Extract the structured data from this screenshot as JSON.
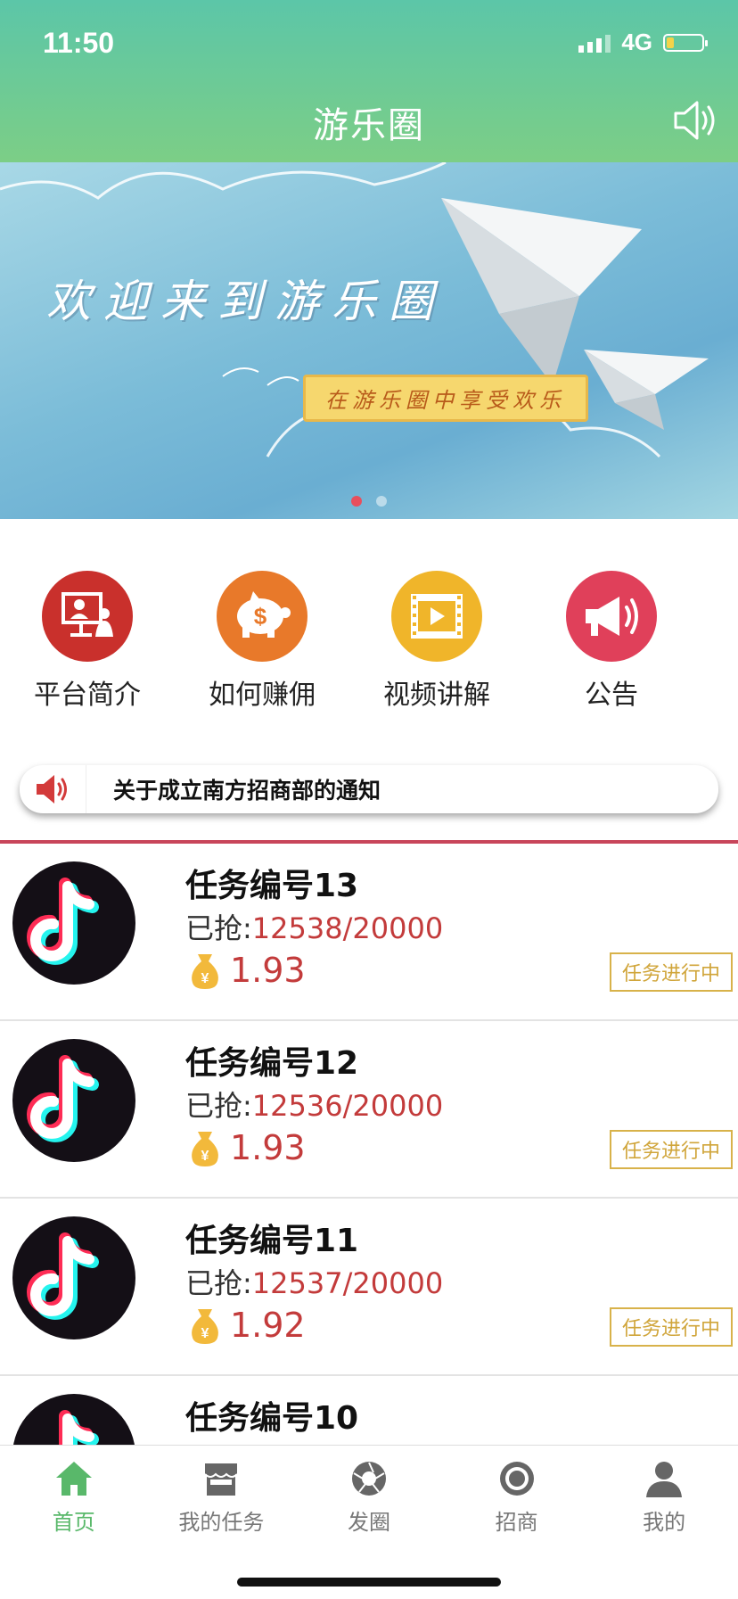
{
  "status_bar": {
    "time": "11:50",
    "network": "4G"
  },
  "header": {
    "title": "游乐圈"
  },
  "banner": {
    "headline": "欢迎来到游乐圈",
    "subtitle": "在游乐圈中享受欢乐",
    "slide_count": 2,
    "active_slide": 1
  },
  "quick_nav": [
    {
      "label": "平台简介",
      "icon": "presentation-icon",
      "color": "#c9302c"
    },
    {
      "label": "如何赚佣",
      "icon": "piggy-bank-icon",
      "color": "#e8792a"
    },
    {
      "label": "视频讲解",
      "icon": "film-icon",
      "color": "#f0b52a"
    },
    {
      "label": "公告",
      "icon": "megaphone-icon",
      "color": "#e0405a"
    }
  ],
  "notice": {
    "text": "关于成立南方招商部的通知"
  },
  "tasks": [
    {
      "title": "任务编号13",
      "progress_label": "已抢:",
      "progress": "12538/20000",
      "reward": "1.93",
      "status": "任务进行中"
    },
    {
      "title": "任务编号12",
      "progress_label": "已抢:",
      "progress": "12536/20000",
      "reward": "1.93",
      "status": "任务进行中"
    },
    {
      "title": "任务编号11",
      "progress_label": "已抢:",
      "progress": "12537/20000",
      "reward": "1.92",
      "status": "任务进行中"
    },
    {
      "title": "任务编号10"
    }
  ],
  "tabbar": [
    {
      "label": "首页",
      "icon": "home-icon",
      "active": true
    },
    {
      "label": "我的任务",
      "icon": "shop-icon",
      "active": false
    },
    {
      "label": "发圈",
      "icon": "aperture-icon",
      "active": false
    },
    {
      "label": "招商",
      "icon": "circle-icon",
      "active": false
    },
    {
      "label": "我的",
      "icon": "user-icon",
      "active": false
    }
  ],
  "colors": {
    "header_start": "#5cc6a8",
    "header_end": "#7cce86",
    "accent_red": "#c33b3b",
    "tab_active": "#59b86a",
    "tag_gold": "#d0a53a"
  }
}
